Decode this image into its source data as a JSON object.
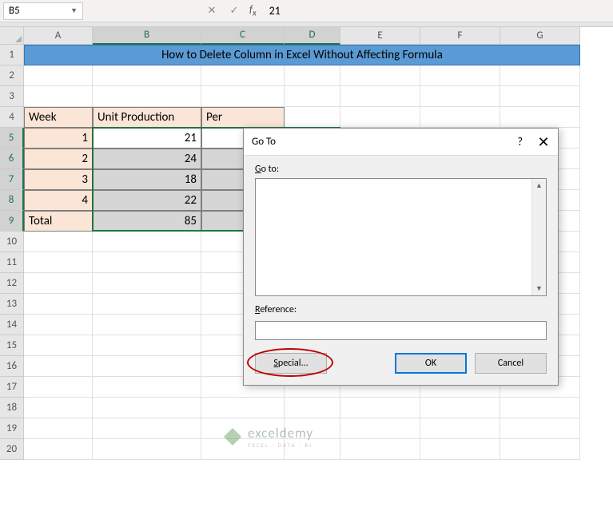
{
  "namebox": {
    "ref": "B5"
  },
  "formula_bar": {
    "value": "21"
  },
  "columns": [
    {
      "letter": "A",
      "w": 86,
      "sel": false
    },
    {
      "letter": "B",
      "w": 136,
      "sel": true
    },
    {
      "letter": "C",
      "w": 104,
      "sel": true
    },
    {
      "letter": "D",
      "w": 70,
      "sel": true
    },
    {
      "letter": "E",
      "w": 100,
      "sel": false
    },
    {
      "letter": "F",
      "w": 100,
      "sel": false
    },
    {
      "letter": "G",
      "w": 100,
      "sel": false
    }
  ],
  "title_row": {
    "text": "How to Delete Column in Excel Without Affecting Formula"
  },
  "table": {
    "headers": {
      "a": "Week",
      "b": "Unit Production",
      "c": "Per"
    },
    "rows": [
      {
        "week": "1",
        "val": "21"
      },
      {
        "week": "2",
        "val": "24"
      },
      {
        "week": "3",
        "val": "18"
      },
      {
        "week": "4",
        "val": "22"
      }
    ],
    "total": {
      "label": "Total",
      "val": "85"
    }
  },
  "row_numbers": [
    "1",
    "2",
    "3",
    "4",
    "5",
    "6",
    "7",
    "8",
    "9",
    "10",
    "11",
    "12",
    "13",
    "14",
    "15",
    "16",
    "17",
    "18",
    "19",
    "20"
  ],
  "sel_rows": [
    5,
    6,
    7,
    8,
    9
  ],
  "dialog": {
    "title": "Go To",
    "help": "?",
    "goto_label": "Go to:",
    "ref_label": "Reference:",
    "ref_value": "",
    "special": "Special...",
    "ok": "OK",
    "cancel": "Cancel"
  },
  "watermark": {
    "brand": "exceldemy",
    "sub": "EXCEL · DATA · BI"
  }
}
